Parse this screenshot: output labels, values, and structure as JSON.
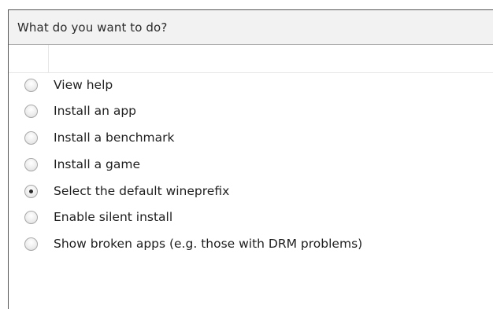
{
  "dialog": {
    "prompt": "What do you want to do?"
  },
  "options": [
    {
      "label": "View help",
      "checked": false
    },
    {
      "label": "Install an app",
      "checked": false
    },
    {
      "label": "Install a benchmark",
      "checked": false
    },
    {
      "label": "Install a game",
      "checked": false
    },
    {
      "label": "Select the default wineprefix",
      "checked": true
    },
    {
      "label": "Enable silent install",
      "checked": false
    },
    {
      "label": "Show broken apps (e.g. those with DRM problems)",
      "checked": false
    }
  ]
}
